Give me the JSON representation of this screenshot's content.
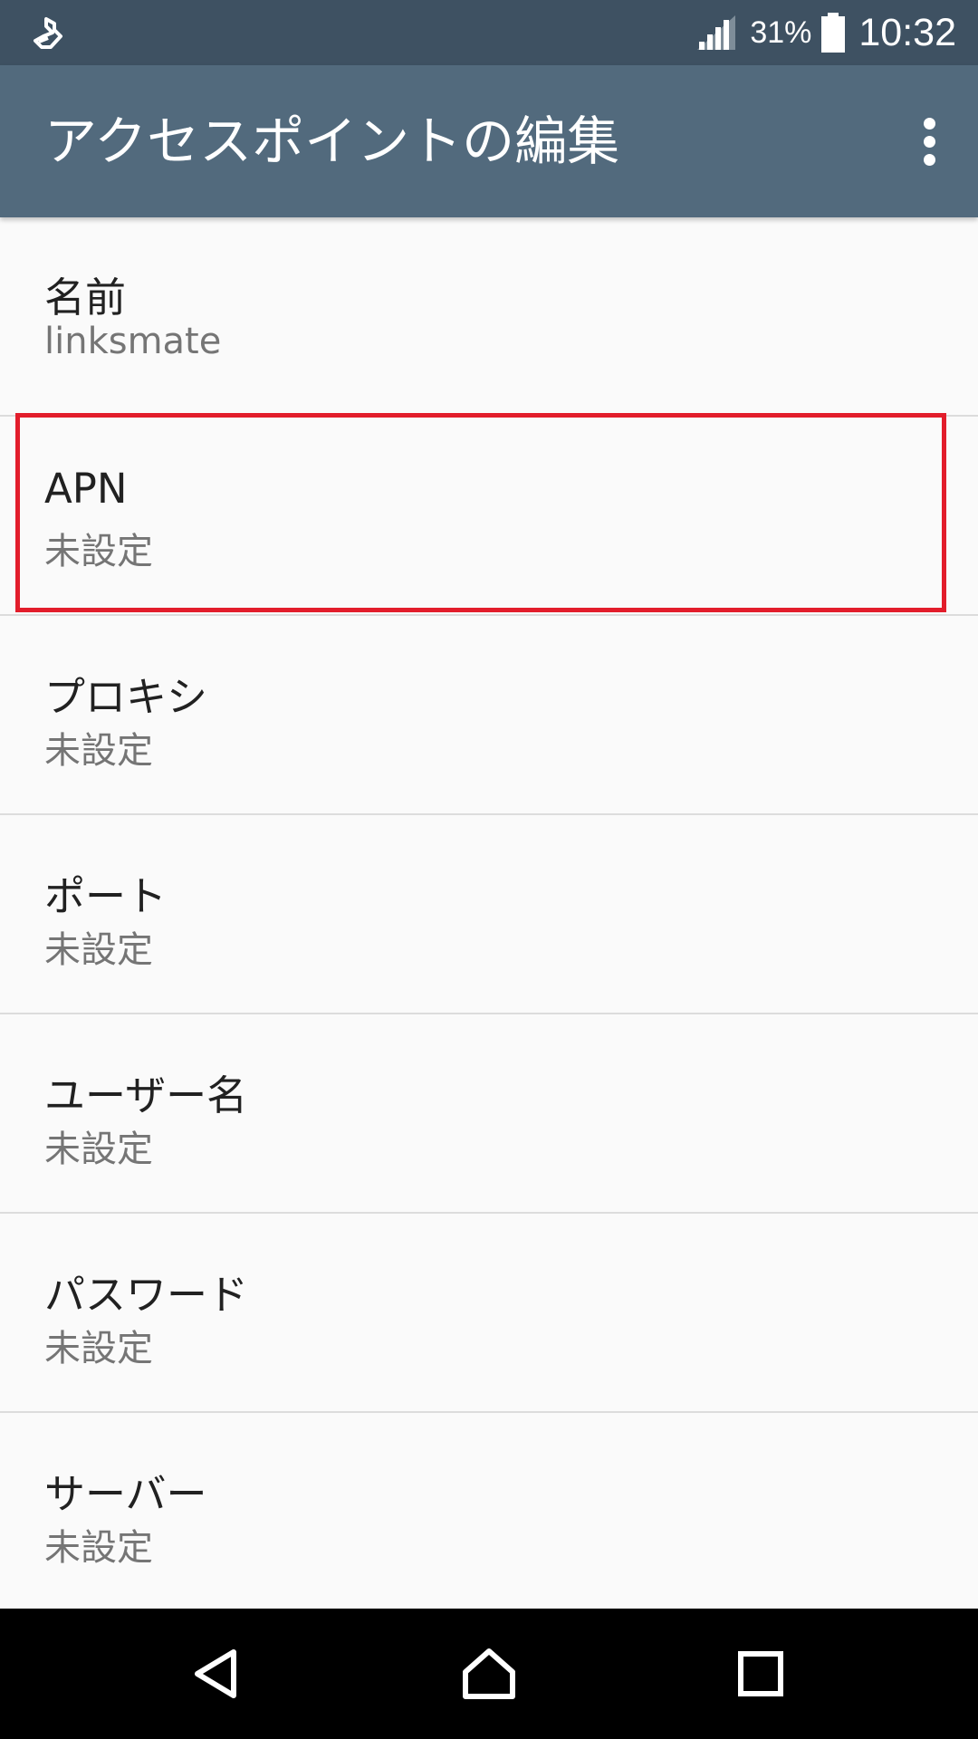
{
  "status_bar": {
    "battery_percent": "31%",
    "time": "10:32",
    "icons": [
      "download-notification-icon",
      "signal-icon",
      "battery-icon"
    ]
  },
  "app_bar": {
    "title": "アクセスポイントの編集",
    "menu_icon": "more-vert-icon"
  },
  "settings": {
    "items": [
      {
        "title": "名前",
        "summary": "linksmate"
      },
      {
        "title": "APN",
        "summary": "未設定"
      },
      {
        "title": "プロキシ",
        "summary": "未設定"
      },
      {
        "title": "ポート",
        "summary": "未設定"
      },
      {
        "title": "ユーザー名",
        "summary": "未設定"
      },
      {
        "title": "パスワード",
        "summary": "未設定"
      },
      {
        "title": "サーバー",
        "summary": "未設定"
      }
    ],
    "highlighted_item": "APN",
    "highlight_color": "#e21d2b"
  },
  "nav_bar": {
    "buttons": [
      "back-icon",
      "home-icon",
      "recents-icon"
    ]
  },
  "colors": {
    "status_bar": "#3e5162",
    "app_bar": "#526a7d",
    "background": "#fafafa"
  }
}
